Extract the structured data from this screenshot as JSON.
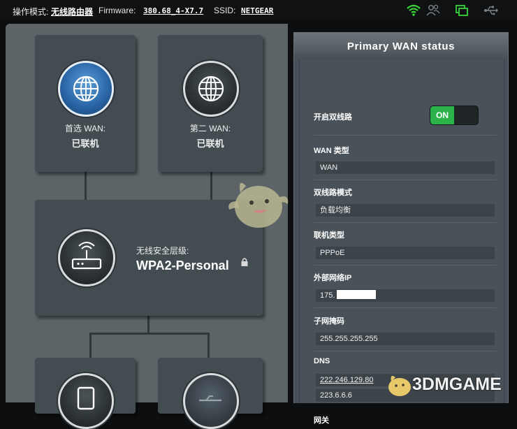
{
  "topbar": {
    "mode_label": "操作模式:",
    "mode_value": "无线路由器",
    "firmware_label": "Firmware:",
    "firmware_value": "380.68_4-X7.7",
    "ssid_label": "SSID:",
    "ssid_value": "NETGEAR",
    "icons": [
      "wifi-icon",
      "users-icon",
      "window-icon",
      "usb-icon"
    ],
    "accent_color": "#3ad33a"
  },
  "network_map": {
    "wan1": {
      "label": "首选 WAN:",
      "status": "已联机",
      "icon": "globe-icon"
    },
    "wan2": {
      "label": "第二 WAN:",
      "status": "已联机",
      "icon": "globe-icon"
    },
    "router": {
      "security_label": "无线安全层级:",
      "security_value": "WPA2-Personal",
      "icon": "router-icon",
      "lock_icon": "lock-icon"
    },
    "clients": {
      "icon": "device-icon"
    },
    "usb": {
      "icon": "usb-icon"
    }
  },
  "panel": {
    "title": "Primary WAN status",
    "dual_wan_label": "开启双线路",
    "dual_wan_toggle": "ON",
    "wan_type_label": "WAN 类型",
    "wan_type_value": "WAN",
    "dual_wan_mode_label": "双线路模式",
    "dual_wan_mode_value": "负载均衡",
    "connection_type_label": "联机类型",
    "connection_type_value": "PPPoE",
    "wan_ip_label": "外部网络IP",
    "wan_ip_value": "175.",
    "subnet_label": "子网掩码",
    "subnet_value": "255.255.255.255",
    "dns_label": "DNS",
    "dns_primary": "222.246.129.80",
    "dns_secondary": "223.6.6.6",
    "gateway_label": "网关"
  },
  "watermark": {
    "text": "3DMGAME"
  }
}
